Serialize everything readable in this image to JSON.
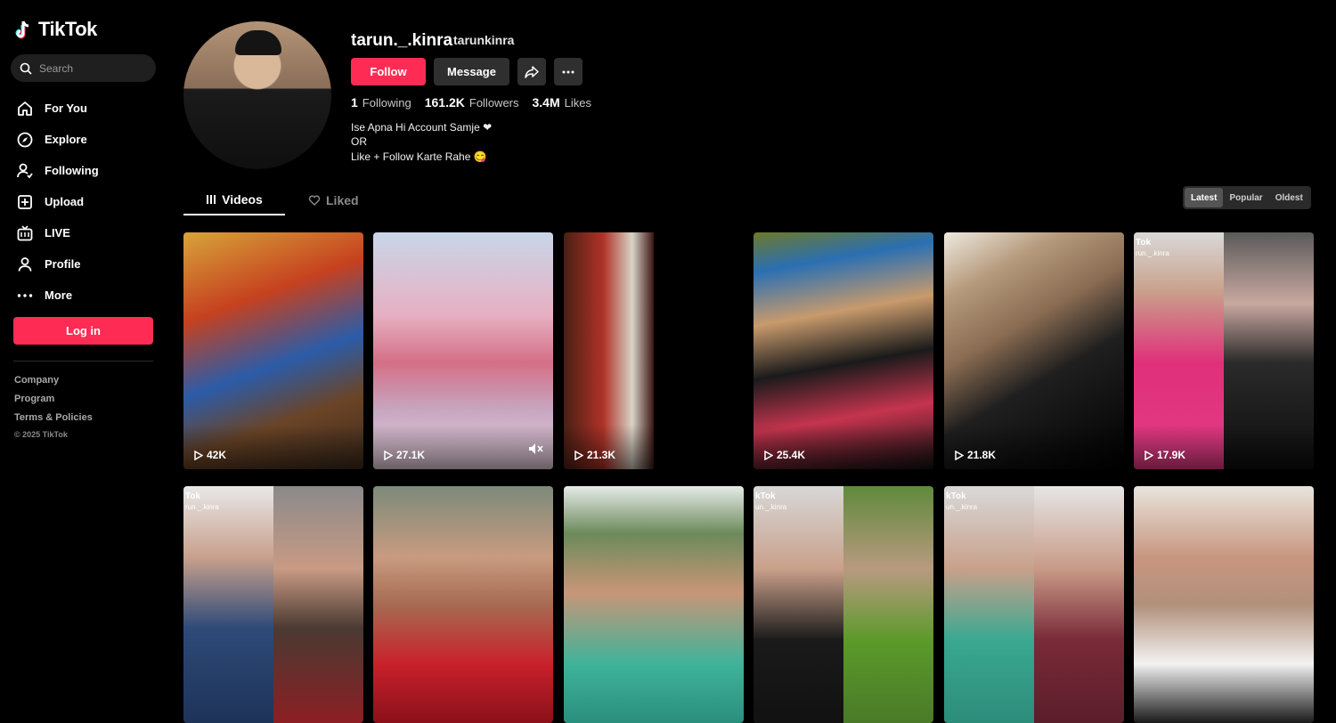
{
  "app": {
    "name": "TikTok"
  },
  "search": {
    "placeholder": "Search"
  },
  "nav": [
    {
      "label": "For You",
      "icon": "home-icon"
    },
    {
      "label": "Explore",
      "icon": "compass-icon"
    },
    {
      "label": "Following",
      "icon": "following-icon"
    },
    {
      "label": "Upload",
      "icon": "upload-icon"
    },
    {
      "label": "LIVE",
      "icon": "live-icon"
    },
    {
      "label": "Profile",
      "icon": "profile-icon"
    },
    {
      "label": "More",
      "icon": "more-icon"
    }
  ],
  "login_label": "Log in",
  "footer": {
    "links": [
      "Company",
      "Program",
      "Terms & Policies"
    ],
    "copyright": "© 2025 TikTok"
  },
  "profile": {
    "username": "tarun._.kinra",
    "nickname": "tarunkinra",
    "follow_label": "Follow",
    "message_label": "Message",
    "stats": [
      {
        "value": "1",
        "label": "Following"
      },
      {
        "value": "161.2K",
        "label": "Followers"
      },
      {
        "value": "3.4M",
        "label": "Likes"
      }
    ],
    "bio": [
      "Ise Apna Hi Account Samje ❤",
      "OR",
      "Like + Follow Karte Rahe 😋"
    ]
  },
  "tabs": {
    "videos": "Videos",
    "liked": "Liked"
  },
  "sort": {
    "options": [
      "Latest",
      "Popular",
      "Oldest"
    ],
    "selected": "Latest"
  },
  "videos": [
    {
      "views": "42K"
    },
    {
      "views": "27.1K",
      "muted": true
    },
    {
      "views": "21.3K"
    },
    {
      "views": "25.4K"
    },
    {
      "views": "21.8K"
    },
    {
      "views": "17.9K",
      "watermark": "Tok",
      "watermark_user": "run._.kinra"
    },
    {
      "views": "",
      "watermark": "Tok",
      "watermark_user": "run._.kinra"
    },
    {
      "views": ""
    },
    {
      "views": ""
    },
    {
      "views": "",
      "watermark": "kTok",
      "watermark_user": "un._.kinra"
    },
    {
      "views": "",
      "watermark": "kTok",
      "watermark_user": "un._.kinra"
    },
    {
      "views": ""
    }
  ],
  "colors": {
    "accent": "#fe2c55",
    "background": "#000000",
    "surface": "#2f2f2f"
  }
}
